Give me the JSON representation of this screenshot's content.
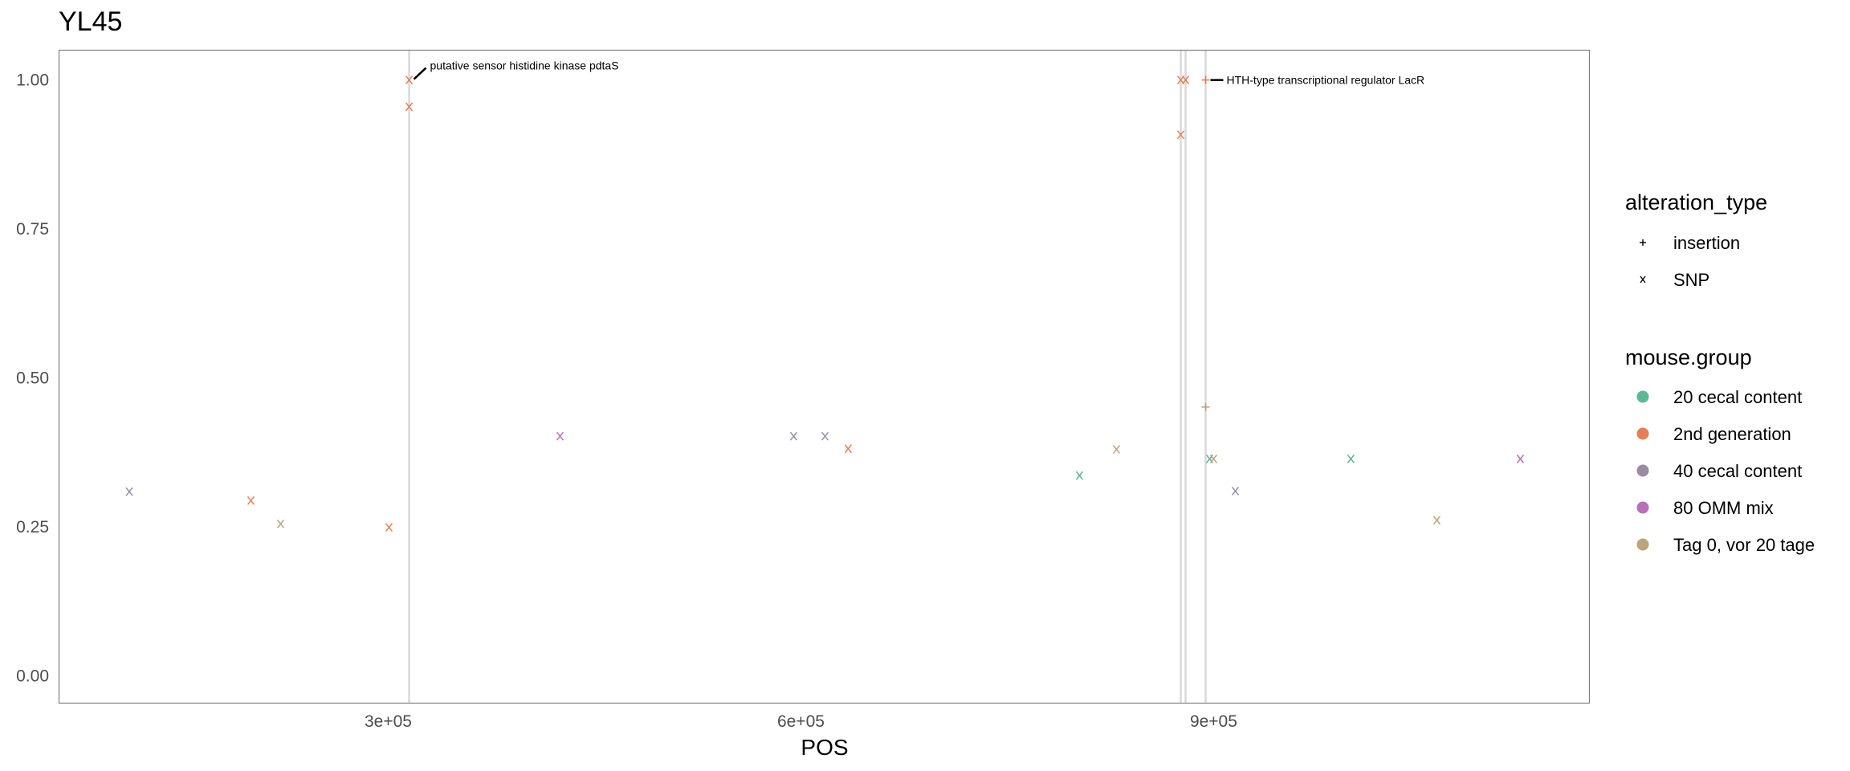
{
  "chart_data": {
    "type": "scatter",
    "title": "YL45",
    "xlabel": "POS",
    "ylabel": "",
    "xlim": [
      60700,
      1173200
    ],
    "ylim": [
      -0.046,
      1.05
    ],
    "x_ticks": [
      {
        "value": 300000,
        "label": "3e+05"
      },
      {
        "value": 600000,
        "label": "6e+05"
      },
      {
        "value": 900000,
        "label": "9e+05"
      }
    ],
    "y_ticks": [
      {
        "value": 0.0,
        "label": "0.00"
      },
      {
        "value": 0.25,
        "label": "0.25"
      },
      {
        "value": 0.5,
        "label": "0.50"
      },
      {
        "value": 0.75,
        "label": "0.75"
      },
      {
        "value": 1.0,
        "label": "1.00"
      }
    ],
    "grid": false,
    "vlines": [
      315200,
      876100,
      879600,
      894200
    ],
    "annotations": [
      {
        "x": 315200,
        "y": 1.0,
        "text": "putative sensor histidine kinase pdtaS"
      },
      {
        "x": 894200,
        "y": 1.0,
        "text": "HTH-type transcriptional regulator LacR"
      }
    ],
    "shape_legend": {
      "title": "alteration_type",
      "position": "right",
      "items": [
        {
          "label": "insertion",
          "symbol": "+"
        },
        {
          "label": "SNP",
          "symbol": "x"
        }
      ]
    },
    "color_legend": {
      "title": "mouse.group",
      "position": "right",
      "items": [
        {
          "label": "20 cecal content",
          "color": "#5bb794"
        },
        {
          "label": "2nd generation",
          "color": "#e57f56"
        },
        {
          "label": "40 cecal content",
          "color": "#9b8ba3"
        },
        {
          "label": "80 OMM mix",
          "color": "#b96fba"
        },
        {
          "label": "Tag 0, vor 20 tage",
          "color": "#bca57b"
        }
      ]
    },
    "points": [
      {
        "x": 111800,
        "y": 0.309,
        "group": "40 cecal content",
        "type": "SNP"
      },
      {
        "x": 200200,
        "y": 0.294,
        "group": "2nd generation",
        "type": "SNP"
      },
      {
        "x": 221800,
        "y": 0.255,
        "group": "Tag 0, vor 20 tage",
        "type": "SNP"
      },
      {
        "x": 300600,
        "y": 0.249,
        "group": "2nd generation",
        "type": "SNP"
      },
      {
        "x": 315200,
        "y": 1.0,
        "group": "2nd generation",
        "type": "SNP"
      },
      {
        "x": 315200,
        "y": 0.955,
        "group": "2nd generation",
        "type": "SNP"
      },
      {
        "x": 424900,
        "y": 0.402,
        "group": "80 OMM mix",
        "type": "SNP"
      },
      {
        "x": 594750,
        "y": 0.402,
        "group": "40 cecal content",
        "type": "SNP"
      },
      {
        "x": 617500,
        "y": 0.402,
        "group": "40 cecal content",
        "type": "SNP"
      },
      {
        "x": 634400,
        "y": 0.381,
        "group": "2nd generation",
        "type": "SNP"
      },
      {
        "x": 802500,
        "y": 0.336,
        "group": "20 cecal content",
        "type": "SNP"
      },
      {
        "x": 829400,
        "y": 0.38,
        "group": "Tag 0, vor 20 tage",
        "type": "SNP"
      },
      {
        "x": 876100,
        "y": 1.0,
        "group": "2nd generation",
        "type": "SNP"
      },
      {
        "x": 879600,
        "y": 1.0,
        "group": "2nd generation",
        "type": "SNP"
      },
      {
        "x": 876100,
        "y": 0.908,
        "group": "2nd generation",
        "type": "SNP"
      },
      {
        "x": 894200,
        "y": 1.0,
        "group": "2nd generation",
        "type": "insertion"
      },
      {
        "x": 894200,
        "y": 0.451,
        "group": "Tag 0, vor 20 tage",
        "type": "insertion"
      },
      {
        "x": 897100,
        "y": 0.364,
        "group": "20 cecal content",
        "type": "SNP"
      },
      {
        "x": 900000,
        "y": 0.364,
        "group": "Tag 0, vor 20 tage",
        "type": "SNP"
      },
      {
        "x": 915800,
        "y": 0.31,
        "group": "40 cecal content",
        "type": "SNP"
      },
      {
        "x": 999800,
        "y": 0.364,
        "group": "20 cecal content",
        "type": "SNP"
      },
      {
        "x": 1062300,
        "y": 0.261,
        "group": "Tag 0, vor 20 tage",
        "type": "SNP"
      },
      {
        "x": 1123000,
        "y": 0.364,
        "group": "80 OMM mix",
        "type": "SNP"
      }
    ]
  }
}
